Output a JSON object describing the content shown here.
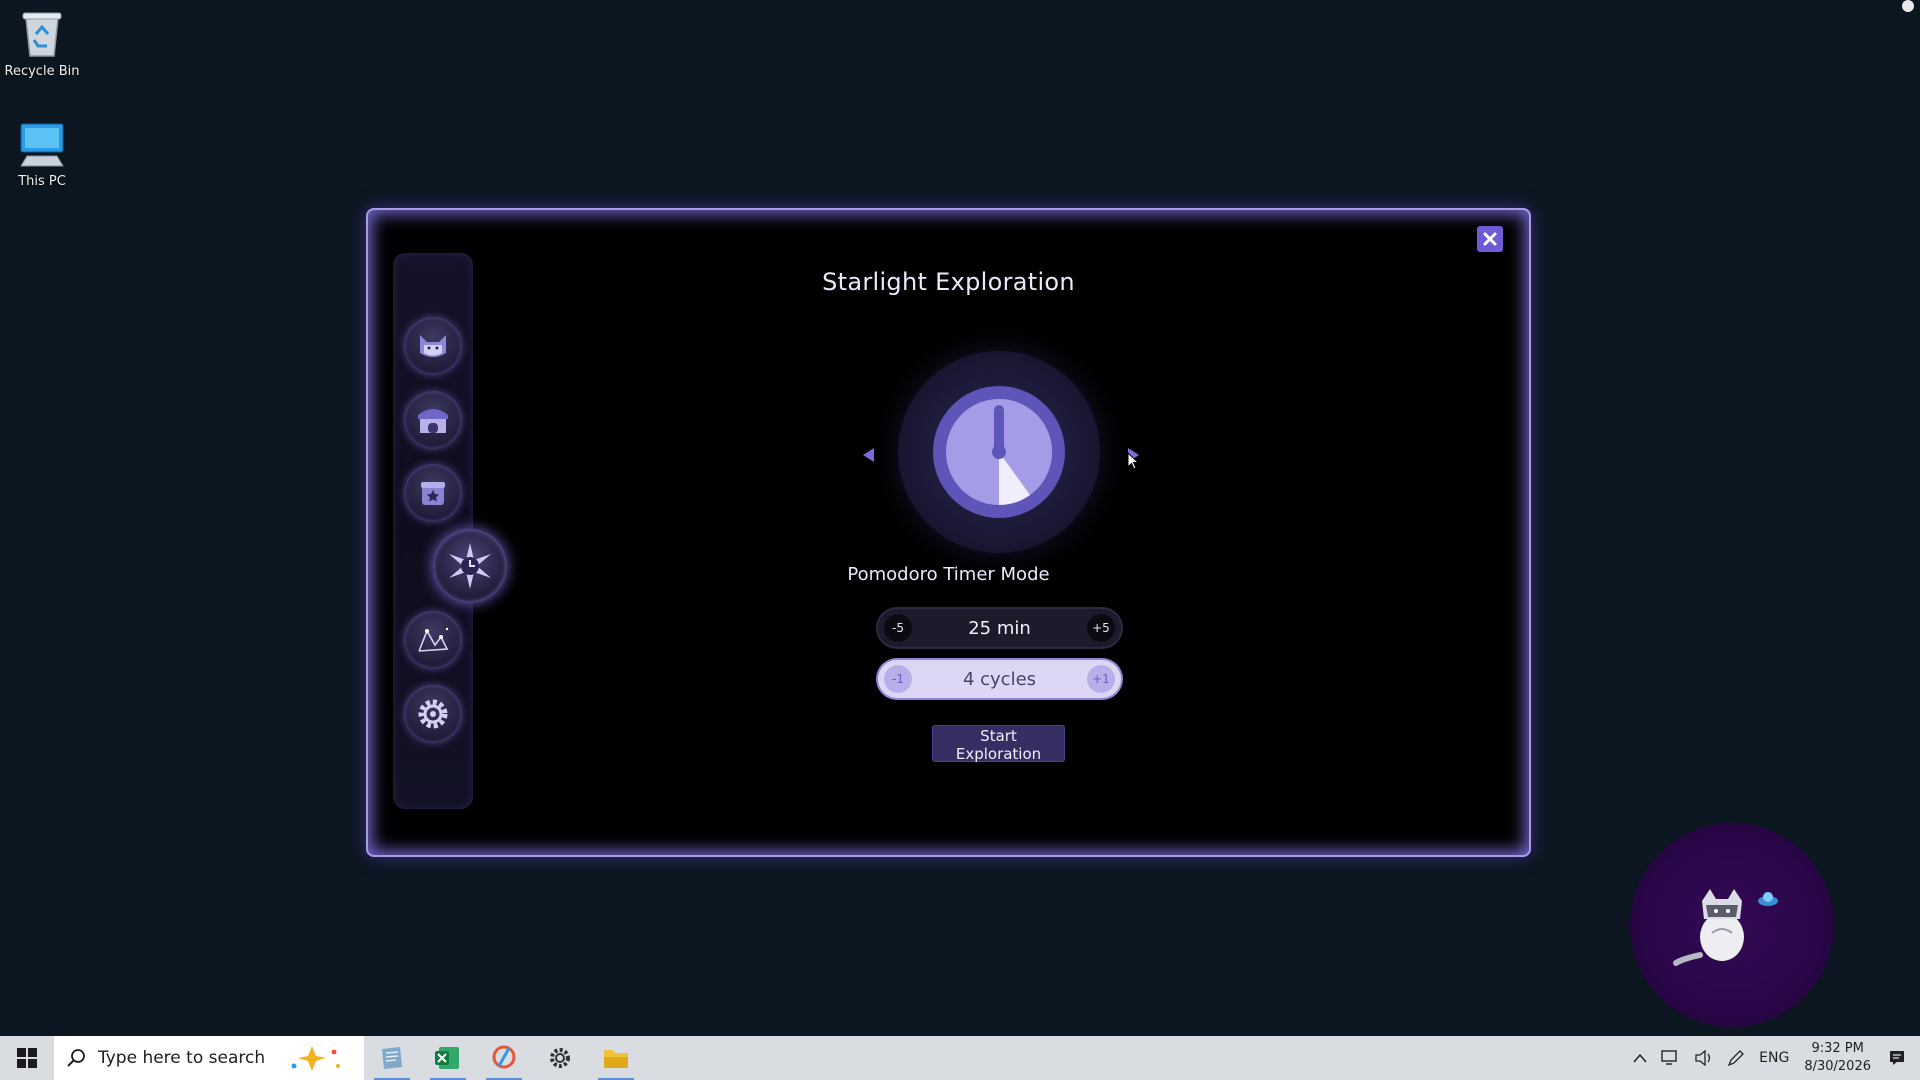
{
  "desktop": {
    "icons": [
      {
        "label": "Recycle Bin",
        "icon": "recycle-bin-icon"
      },
      {
        "label": "This PC",
        "icon": "computer-icon"
      }
    ]
  },
  "window": {
    "title": "Starlight Exploration",
    "close_icon": "close-icon",
    "sidebar": [
      {
        "icon": "cat-icon"
      },
      {
        "icon": "shop-icon"
      },
      {
        "icon": "bag-icon"
      },
      {
        "icon": "star-clock-icon",
        "active": true
      },
      {
        "icon": "constellation-icon"
      },
      {
        "icon": "gear-icon"
      }
    ],
    "mode_label": "Pomodoro Timer Mode",
    "duration": {
      "value": "25 min",
      "minus": "-5",
      "plus": "+5"
    },
    "cycles": {
      "value": "4 cycles",
      "minus": "-1",
      "plus": "+1"
    },
    "start_button": "Start Exploration"
  },
  "taskbar": {
    "search_placeholder": "Type here to search",
    "apps": [
      "notes-icon",
      "excel-icon",
      "drawing-app-icon",
      "settings-icon",
      "file-explorer-icon"
    ],
    "language": "ENG",
    "time": "9:32 PM",
    "date": "8/30/2026"
  },
  "colors": {
    "accent": "#6d5bd6",
    "window_glow": "#a89be6",
    "desktop_bg": "#0b1620"
  }
}
